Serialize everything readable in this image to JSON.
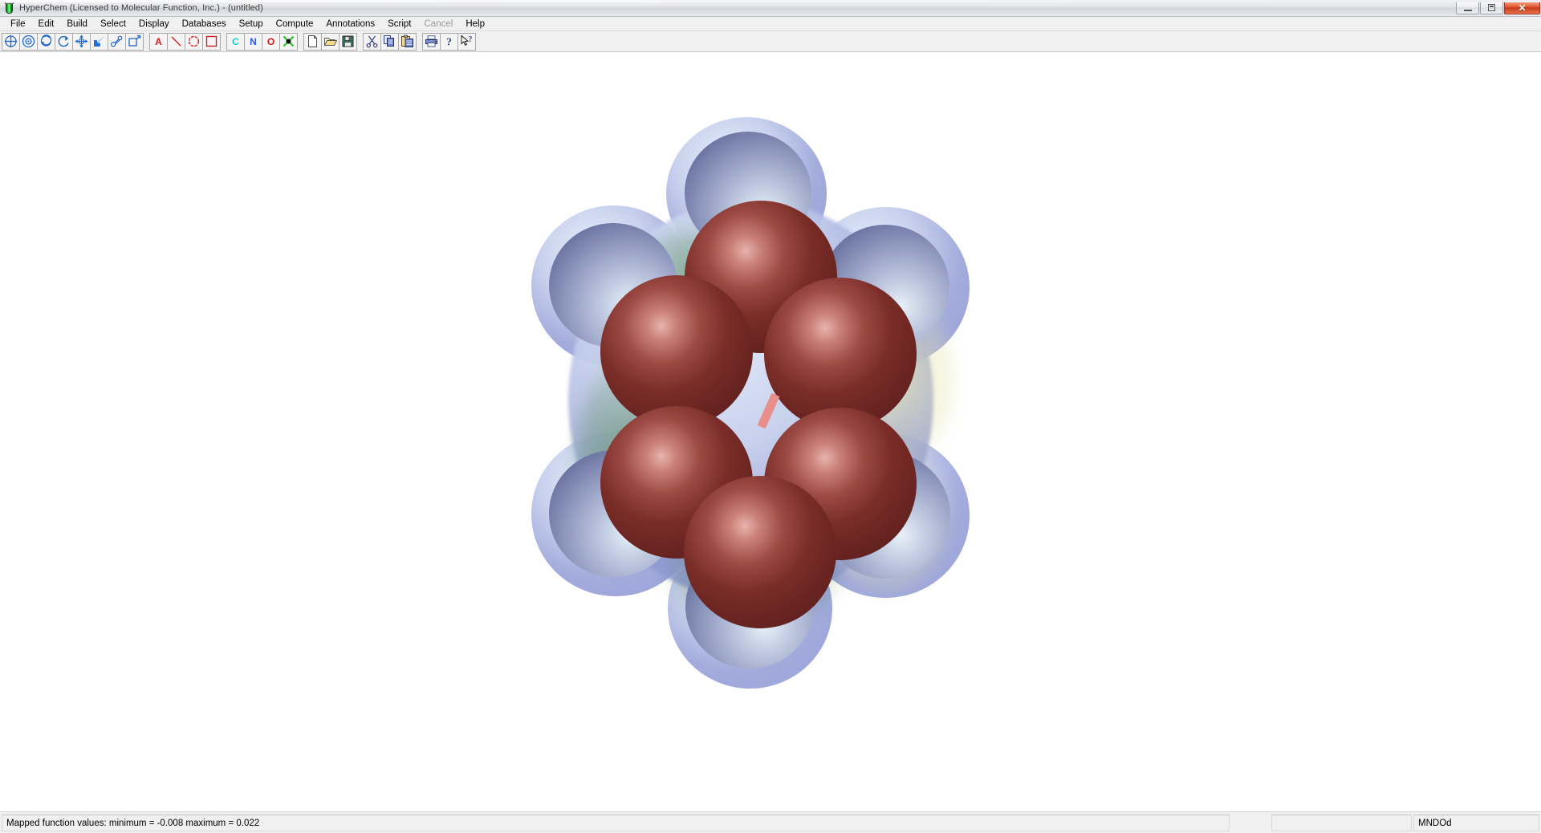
{
  "window": {
    "title": "HyperChem (Licensed to Molecular Function, Inc.) - (untitled)",
    "icon": "beaker-icon",
    "minimize_label": "",
    "restore_label": "",
    "close_label": "✕"
  },
  "menubar": {
    "items": [
      {
        "label": "File",
        "disabled": false
      },
      {
        "label": "Edit",
        "disabled": false
      },
      {
        "label": "Build",
        "disabled": false
      },
      {
        "label": "Select",
        "disabled": false
      },
      {
        "label": "Display",
        "disabled": false
      },
      {
        "label": "Databases",
        "disabled": false
      },
      {
        "label": "Setup",
        "disabled": false
      },
      {
        "label": "Compute",
        "disabled": false
      },
      {
        "label": "Annotations",
        "disabled": false
      },
      {
        "label": "Script",
        "disabled": false
      },
      {
        "label": "Cancel",
        "disabled": true
      },
      {
        "label": "Help",
        "disabled": false
      }
    ]
  },
  "toolbar": {
    "groups": [
      {
        "name": "tools",
        "buttons": [
          {
            "icon": "select-crosshair-circle-icon",
            "label": ""
          },
          {
            "icon": "magnify-circle-icon",
            "label": ""
          },
          {
            "icon": "rotate-xy-icon",
            "label": ""
          },
          {
            "icon": "rotate-z-icon",
            "label": ""
          },
          {
            "icon": "translate-arrows-icon",
            "label": ""
          },
          {
            "icon": "zoom-arrow-icon",
            "label": ""
          },
          {
            "icon": "draw-bond-icon",
            "label": ""
          },
          {
            "icon": "zoom-box-icon",
            "label": ""
          }
        ]
      },
      {
        "name": "annotation",
        "buttons": [
          {
            "icon": "text-a-icon",
            "label": "A",
            "color": "#cc2222"
          },
          {
            "icon": "line-icon",
            "label": "",
            "color": "#cc2222"
          },
          {
            "icon": "circle-icon",
            "label": "",
            "color": "#cc2222"
          },
          {
            "icon": "rectangle-icon",
            "label": "",
            "color": "#cc2222"
          }
        ]
      },
      {
        "name": "elements",
        "buttons": [
          {
            "icon": "element-c-icon",
            "label": "C",
            "color": "#11c8d8"
          },
          {
            "icon": "element-n-icon",
            "label": "N",
            "color": "#2c5fd8"
          },
          {
            "icon": "element-o-icon",
            "label": "O",
            "color": "#d11b1b"
          },
          {
            "icon": "element-x-icon",
            "label": "X",
            "color": "#22c022"
          }
        ]
      },
      {
        "name": "file-edit",
        "buttons": [
          {
            "icon": "new-file-icon",
            "label": ""
          },
          {
            "icon": "open-folder-icon",
            "label": ""
          },
          {
            "icon": "save-disk-icon",
            "label": ""
          }
        ]
      },
      {
        "name": "clipboard",
        "buttons": [
          {
            "icon": "cut-scissors-icon",
            "label": ""
          },
          {
            "icon": "copy-icon",
            "label": ""
          },
          {
            "icon": "paste-icon",
            "label": ""
          }
        ]
      },
      {
        "name": "help",
        "buttons": [
          {
            "icon": "print-icon",
            "label": ""
          },
          {
            "icon": "help-question-icon",
            "label": ""
          },
          {
            "icon": "context-help-icon",
            "label": ""
          }
        ]
      }
    ]
  },
  "workspace": {
    "molecule_name": "benzene-isosurface-render",
    "render_mode": "space-filling-with-mapped-isosurface",
    "background_color": "#ffffff"
  },
  "statusbar": {
    "message": "Mapped function values: minimum = -0.008 maximum = 0.022",
    "progress_value": "",
    "method": "MNDOd"
  },
  "colors": {
    "carbon_surface": "#6b2b26",
    "carbon_highlight": "#e8b3ae",
    "hydrogen_surface": "#8e97c2",
    "isosurface_blue": "#8f9ad4",
    "isosurface_green": "#3c783c",
    "isosurface_yellow": "#e6e2b4",
    "center_slit": "#e88f8b",
    "titlebar_close": "#d4442a",
    "chrome": "#f0f0f0"
  }
}
